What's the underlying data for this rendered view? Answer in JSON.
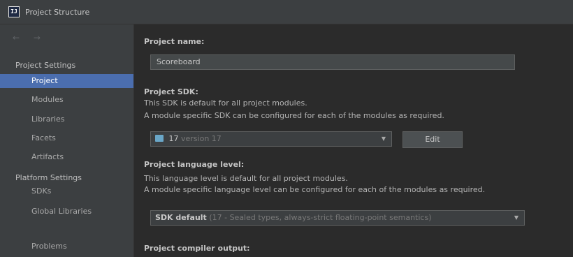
{
  "window": {
    "title": "Project Structure",
    "app_icon_text": "IJ"
  },
  "sidebar": {
    "nav_arrows": "← →",
    "project_settings_header": "Project Settings",
    "project_items": [
      "Project",
      "Modules",
      "Libraries",
      "Facets",
      "Artifacts"
    ],
    "selected_item": "Project",
    "platform_settings_header": "Platform Settings",
    "platform_items": [
      "SDKs",
      "Global Libraries"
    ],
    "problems": "Problems"
  },
  "main": {
    "project_name_label": "Project name:",
    "project_name_value": "Scoreboard",
    "project_sdk_label": "Project SDK:",
    "project_sdk_desc1": "This SDK is default for all project modules.",
    "project_sdk_desc2": "A module specific SDK can be configured for each of the modules as required.",
    "sdk_value": "17",
    "sdk_version": "version 17",
    "edit_button": "Edit",
    "language_level_label": "Project language level:",
    "language_level_desc1": "This language level is default for all project modules.",
    "language_level_desc2": "A module specific language level can be configured for each of the modules as required.",
    "language_level_value": "SDK default",
    "language_level_detail": "(17 - Sealed types, always-strict floating-point semantics)",
    "compiler_output_label": "Project compiler output:"
  },
  "colors": {
    "selection": "#4b6eaf",
    "panel": "#3c3f41",
    "background": "#2b2b2b"
  }
}
